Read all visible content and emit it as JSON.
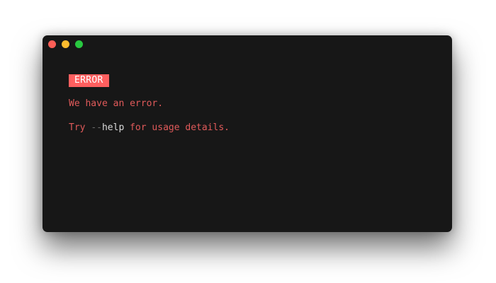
{
  "colors": {
    "close": "#ff5f57",
    "minimize": "#febc2e",
    "zoom": "#28c840",
    "badge_bg": "#ff5f5f",
    "badge_text": "#ffffff",
    "error_text": "#e05a5a",
    "flag_dashes": "#6b6b6b",
    "flag_name": "#d9d9d9"
  },
  "terminal": {
    "badge": "ERROR",
    "message": "We have an error.",
    "hint": {
      "prefix": "Try ",
      "flag_dashes": "--",
      "flag_name": "help",
      "suffix": " for usage details."
    }
  }
}
